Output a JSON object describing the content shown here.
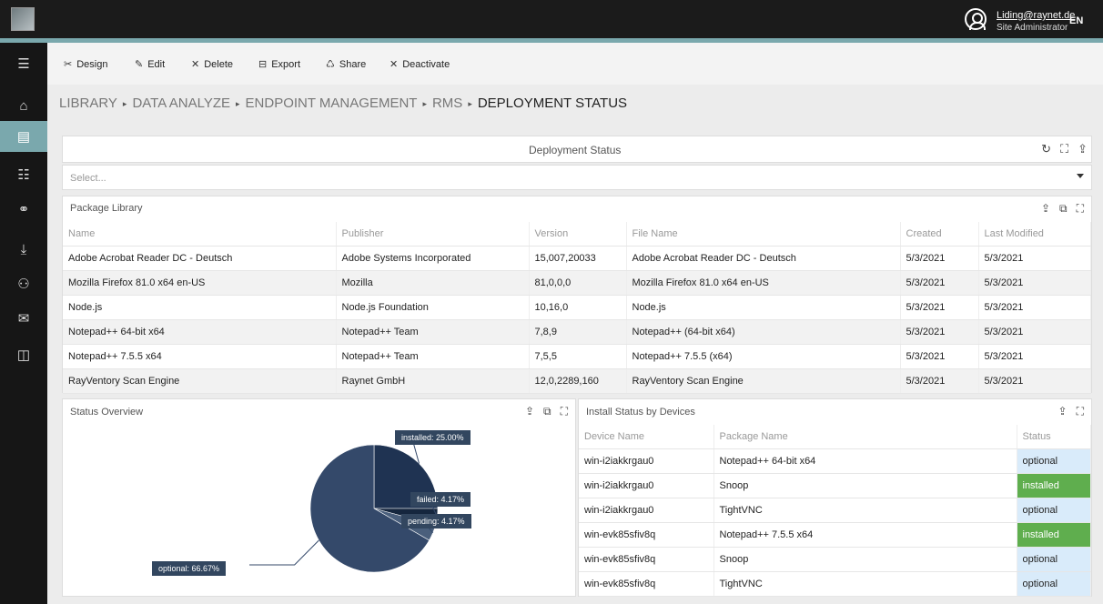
{
  "user": {
    "email": "Liding@raynet.de",
    "role": "Site Administrator",
    "lang": "EN"
  },
  "sidebar": {
    "items": [
      {
        "icon": "menu-icon",
        "glyph": "☰"
      },
      {
        "icon": "home-icon",
        "glyph": "⌂"
      },
      {
        "icon": "dashboard-icon",
        "glyph": "▤",
        "active": true
      },
      {
        "icon": "list-icon",
        "glyph": "☷"
      },
      {
        "icon": "connections-icon",
        "glyph": "⚭"
      },
      {
        "icon": "download-icon",
        "glyph": "⤓"
      },
      {
        "icon": "user-settings-icon",
        "glyph": "⚇"
      },
      {
        "icon": "mail-icon",
        "glyph": "✉"
      },
      {
        "icon": "document-icon",
        "glyph": "◫"
      }
    ]
  },
  "toolbar": {
    "design": {
      "label": "Design",
      "icon": "design-icon",
      "glyph": "✂"
    },
    "edit": {
      "label": "Edit",
      "icon": "pencil-icon",
      "glyph": "✎"
    },
    "delete": {
      "label": "Delete",
      "icon": "close-icon",
      "glyph": "✕"
    },
    "export": {
      "label": "Export",
      "icon": "export-icon",
      "glyph": "⊟"
    },
    "share": {
      "label": "Share",
      "icon": "share-icon",
      "glyph": "♺"
    },
    "deactivate": {
      "label": "Deactivate",
      "icon": "close-icon",
      "glyph": "✕"
    }
  },
  "breadcrumb": [
    "LIBRARY",
    "DATA ANALYZE",
    "ENDPOINT MANAGEMENT",
    "RMS",
    "DEPLOYMENT STATUS"
  ],
  "breadcrumb_sep": "▸",
  "dashboard": {
    "title": "Deployment Status",
    "icons": {
      "refresh": "↻",
      "fullscreen": "⛶",
      "export": "⇪"
    },
    "select_placeholder": "Select..."
  },
  "package_library": {
    "title": "Package Library",
    "columns": [
      "Name",
      "Publisher",
      "Version",
      "File Name",
      "Created",
      "Last Modified"
    ],
    "rows": [
      [
        "Adobe Acrobat Reader DC - Deutsch",
        "Adobe Systems Incorporated",
        "15,007,20033",
        "Adobe Acrobat Reader DC - Deutsch",
        "5/3/2021",
        "5/3/2021"
      ],
      [
        "Mozilla Firefox 81.0 x64 en-US",
        "Mozilla",
        "81,0,0,0",
        "Mozilla Firefox 81.0 x64 en-US",
        "5/3/2021",
        "5/3/2021"
      ],
      [
        "Node.js",
        "Node.js Foundation",
        "10,16,0",
        "Node.js",
        "5/3/2021",
        "5/3/2021"
      ],
      [
        "Notepad++ 64-bit x64",
        "Notepad++ Team",
        "7,8,9",
        "Notepad++ (64-bit x64)",
        "5/3/2021",
        "5/3/2021"
      ],
      [
        "Notepad++ 7.5.5 x64",
        "Notepad++ Team",
        "7,5,5",
        "Notepad++ 7.5.5 (x64)",
        "5/3/2021",
        "5/3/2021"
      ],
      [
        "RayVentory Scan Engine",
        "Raynet GmbH",
        "12,0,2289,160",
        "RayVentory Scan Engine",
        "5/3/2021",
        "5/3/2021"
      ]
    ]
  },
  "status_overview": {
    "title": "Status Overview"
  },
  "install_status": {
    "title": "Install Status by Devices",
    "columns": [
      "Device Name",
      "Package Name",
      "Status"
    ],
    "rows": [
      [
        "win-i2iakkrgau0",
        "Notepad++ 64-bit x64",
        "optional"
      ],
      [
        "win-i2iakkrgau0",
        "Snoop",
        "installed"
      ],
      [
        "win-i2iakkrgau0",
        "TightVNC",
        "optional"
      ],
      [
        "win-evk85sfiv8q",
        "Notepad++ 7.5.5 x64",
        "installed"
      ],
      [
        "win-evk85sfiv8q",
        "Snoop",
        "optional"
      ],
      [
        "win-evk85sfiv8q",
        "TightVNC",
        "optional"
      ]
    ]
  },
  "chart_data": {
    "type": "pie",
    "slices": [
      {
        "label": "installed",
        "value": 25.0,
        "text": "installed: 25.00%",
        "color": "#1f3352"
      },
      {
        "label": "failed",
        "value": 4.17,
        "text": "failed: 4.17%",
        "color": "#15263e"
      },
      {
        "label": "pending",
        "value": 4.17,
        "text": "pending: 4.17%",
        "color": "#4a5f7c"
      },
      {
        "label": "optional",
        "value": 66.67,
        "text": "optional: 66.67%",
        "color": "#34496a"
      }
    ]
  }
}
